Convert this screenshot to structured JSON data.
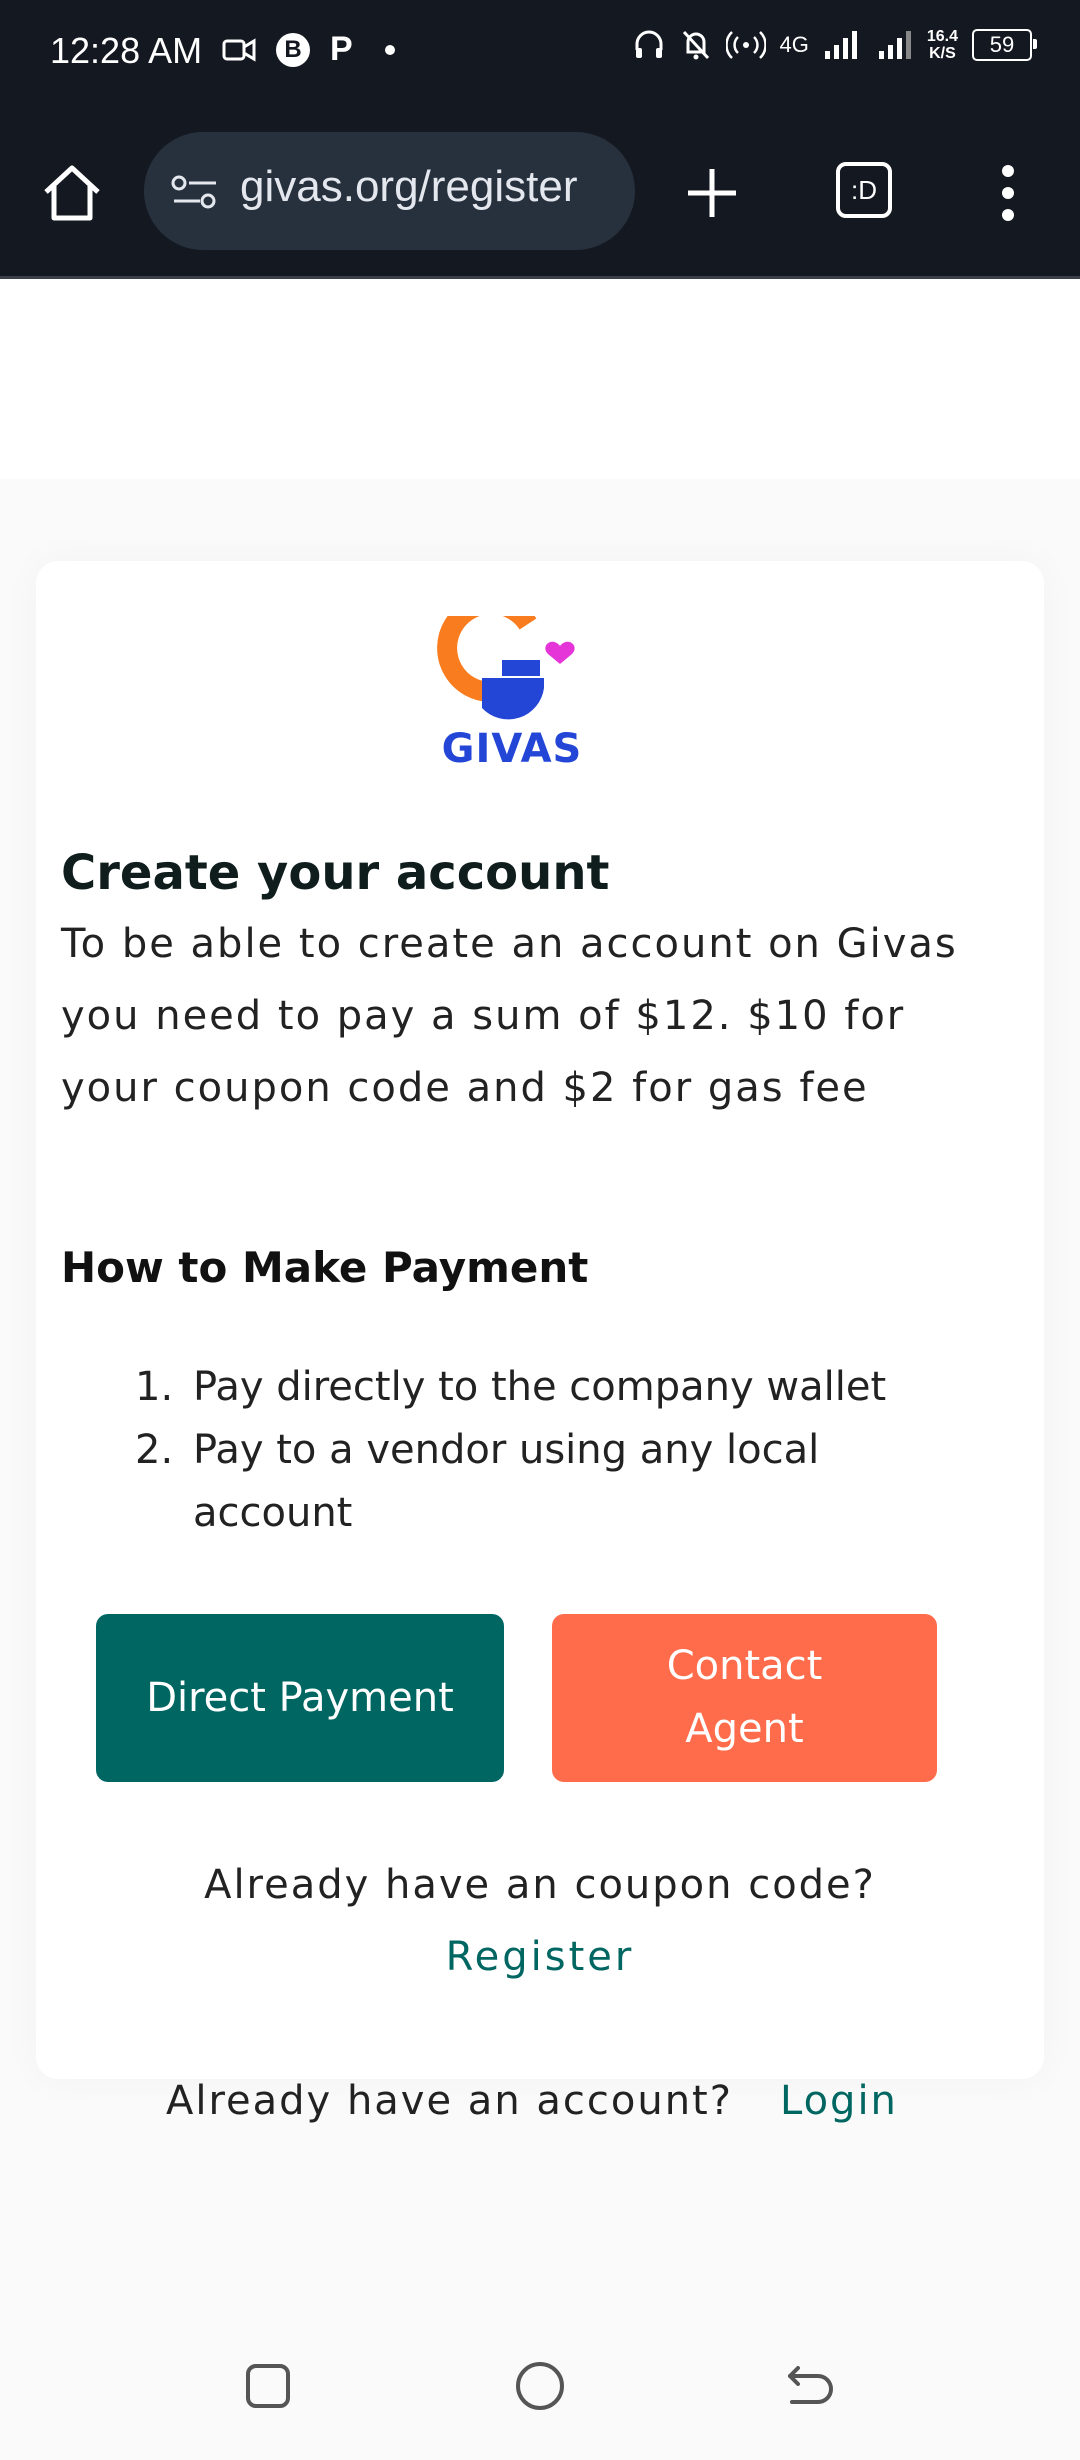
{
  "status_bar": {
    "time": "12:28 AM",
    "badge_b": "B",
    "badge_p": "P",
    "network": "4G",
    "speed_value": "16.4",
    "speed_unit": "K/S",
    "battery": "59"
  },
  "browser": {
    "url": "givas.org/register",
    "tab_switcher_label": ":D"
  },
  "brand": {
    "name": "GIVAS",
    "colors": {
      "primary": "#006661",
      "accent": "#ff6c4b",
      "logo_blue": "#2346d6",
      "logo_orange": "#f97c1e",
      "logo_heart": "#e535d9"
    }
  },
  "main": {
    "title": "Create your account",
    "intro": "To be able to create an account on Givas you need to pay a sum of $12. $10 for your coupon code and $2 for gas fee",
    "payment_heading": "How to Make Payment",
    "steps": [
      {
        "num": "1.",
        "text": "Pay directly to the company wallet"
      },
      {
        "num": "2.",
        "text": "Pay to a vendor using any local account"
      }
    ],
    "direct_payment_label": "Direct Payment",
    "contact_agent_label": "Contact Agent",
    "coupon_prompt": "Already have an coupon code?",
    "register_label": "Register",
    "account_prompt": "Already have an account?",
    "login_label": "Login"
  },
  "icons": {
    "home": "home-icon",
    "url_tune": "tune-icon",
    "new_tab": "plus-icon",
    "tabs": "tabs-icon",
    "menu": "more-vert-icon",
    "nav_recents": "square-icon",
    "nav_home": "circle-icon",
    "nav_back": "back-icon"
  }
}
